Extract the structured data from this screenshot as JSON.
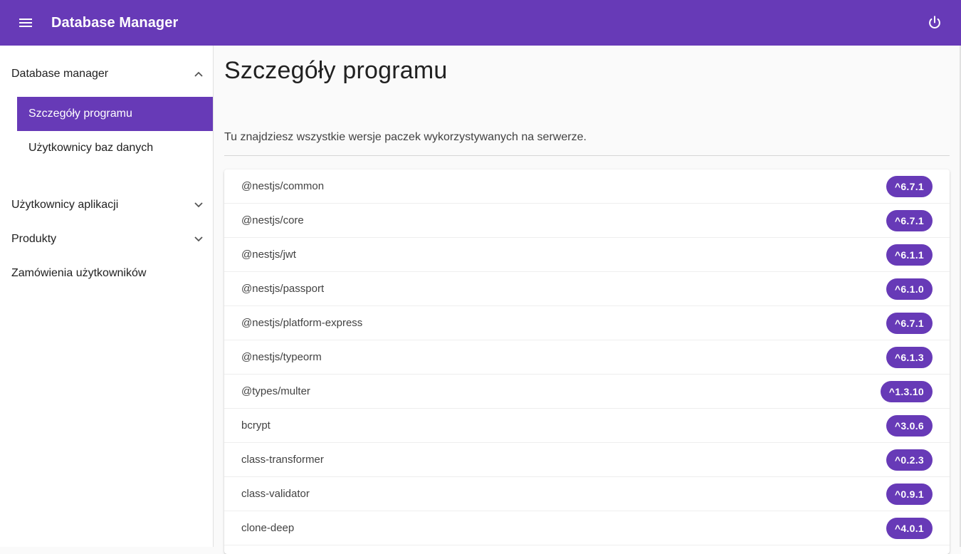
{
  "appbar": {
    "title": "Database Manager",
    "menu_icon": "hamburger-menu-icon",
    "logout_icon": "power-icon",
    "color": "#673ab7"
  },
  "sidebar": {
    "groups": [
      {
        "label": "Database manager",
        "expanded": true,
        "chevron": "chevron-up-icon",
        "items": [
          {
            "label": "Szczegóły programu",
            "active": true
          },
          {
            "label": "Użytkownicy baz danych",
            "active": false
          }
        ]
      },
      {
        "label": "Użytkownicy aplikacji",
        "expanded": false,
        "chevron": "chevron-down-icon"
      },
      {
        "label": "Produkty",
        "expanded": false,
        "chevron": "chevron-down-icon"
      },
      {
        "label": "Zamówienia użytkowników"
      }
    ]
  },
  "main": {
    "title": "Szczegóły programu",
    "description": "Tu znajdziesz wszystkie wersje paczek wykorzystywanych na serwerze.",
    "packages": [
      {
        "name": "@nestjs/common",
        "version": "^6.7.1"
      },
      {
        "name": "@nestjs/core",
        "version": "^6.7.1"
      },
      {
        "name": "@nestjs/jwt",
        "version": "^6.1.1"
      },
      {
        "name": "@nestjs/passport",
        "version": "^6.1.0"
      },
      {
        "name": "@nestjs/platform-express",
        "version": "^6.7.1"
      },
      {
        "name": "@nestjs/typeorm",
        "version": "^6.1.3"
      },
      {
        "name": "@types/multer",
        "version": "^1.3.10"
      },
      {
        "name": "bcrypt",
        "version": "^3.0.6"
      },
      {
        "name": "class-transformer",
        "version": "^0.2.3"
      },
      {
        "name": "class-validator",
        "version": "^0.9.1"
      },
      {
        "name": "clone-deep",
        "version": "^4.0.1"
      }
    ]
  }
}
